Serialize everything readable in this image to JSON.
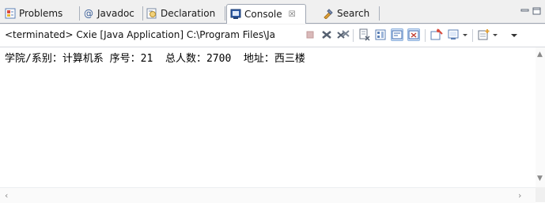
{
  "tabs": [
    {
      "label": "Problems",
      "icon": "problems-icon"
    },
    {
      "label": "Javadoc",
      "icon": "at-icon"
    },
    {
      "label": "Declaration",
      "icon": "declaration-icon"
    },
    {
      "label": "Console",
      "icon": "console-icon",
      "active": true,
      "close": "☒"
    },
    {
      "label": "Search",
      "icon": "search-flashlight-icon"
    }
  ],
  "toolbar": {
    "status": "<terminated> Cxie [Java Application] C:\\Program Files\\Ja"
  },
  "console": {
    "output": "学院/系别：计算机系 序号：21  总人数：2700  地址：西三楼"
  },
  "colors": {
    "tab_border": "#a0a7b3",
    "pressed_button": "#d7e6f8",
    "background": "#ffffff"
  }
}
